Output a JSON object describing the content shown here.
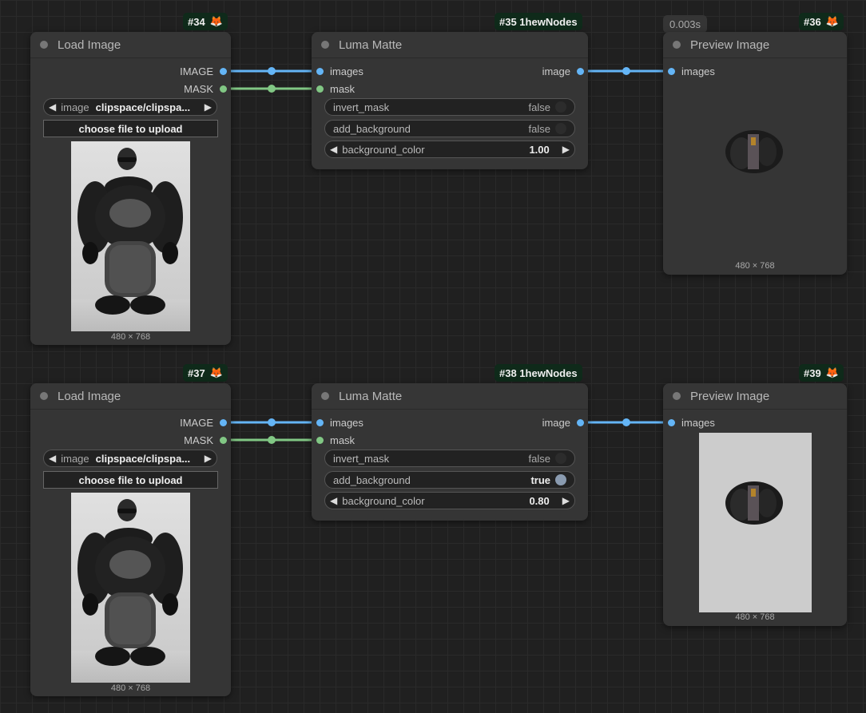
{
  "row1": {
    "load": {
      "badge": "#34",
      "title": "Load Image",
      "out_image": "IMAGE",
      "out_mask": "MASK",
      "combo_name": "image",
      "combo_value": "clipspace/clipspa...",
      "upload_label": "choose file to upload",
      "caption": "480 × 768"
    },
    "luma": {
      "badge": "#35 1hewNodes",
      "title": "Luma Matte",
      "in_images": "images",
      "in_mask": "mask",
      "out_image": "image",
      "w_invert_name": "invert_mask",
      "w_invert_val": "false",
      "w_addbg_name": "add_background",
      "w_addbg_val": "false",
      "w_bgcolor_name": "background_color",
      "w_bgcolor_val": "1.00"
    },
    "preview": {
      "timing": "0.003s",
      "badge": "#36",
      "title": "Preview Image",
      "in_images": "images",
      "caption": "480 × 768"
    }
  },
  "row2": {
    "load": {
      "badge": "#37",
      "title": "Load Image",
      "out_image": "IMAGE",
      "out_mask": "MASK",
      "combo_name": "image",
      "combo_value": "clipspace/clipspa...",
      "upload_label": "choose file to upload",
      "caption": "480 × 768"
    },
    "luma": {
      "badge": "#38 1hewNodes",
      "title": "Luma Matte",
      "in_images": "images",
      "in_mask": "mask",
      "out_image": "image",
      "w_invert_name": "invert_mask",
      "w_invert_val": "false",
      "w_addbg_name": "add_background",
      "w_addbg_val": "true",
      "w_bgcolor_name": "background_color",
      "w_bgcolor_val": "0.80"
    },
    "preview": {
      "badge": "#39",
      "title": "Preview Image",
      "in_images": "images",
      "caption": "480 × 768"
    }
  },
  "colors": {
    "canvas_bg": "#202020",
    "node_bg": "#353535",
    "image_link": "#64b5f6",
    "mask_link": "#81c784",
    "badge_bg": "#0f2a1a"
  },
  "icons": {
    "badge_icon": "fox-icon",
    "combo_left": "triangle-left-icon",
    "combo_right": "triangle-right-icon"
  }
}
